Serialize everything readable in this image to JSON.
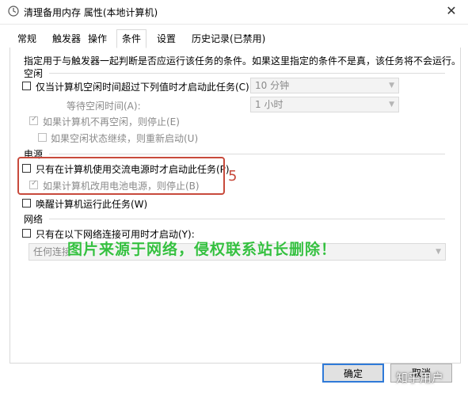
{
  "window": {
    "title": "清理备用内存 属性(本地计算机)",
    "close_label": "✕"
  },
  "tabs": [
    {
      "label": "常规"
    },
    {
      "label": "触发器"
    },
    {
      "label": "操作"
    },
    {
      "label": "条件",
      "active": true
    },
    {
      "label": "设置"
    },
    {
      "label": "历史记录(已禁用)"
    }
  ],
  "conditions": {
    "description": "指定用于与触发器一起判断是否应运行该任务的条件。如果这里指定的条件不是真，该任务将不会运行。",
    "idle": {
      "section_label": "空闲",
      "start_if_idle": {
        "label": "仅当计算机空闲时间超过下列值时才启动此任务(C):",
        "checked": false,
        "dropdown_value": "10 分钟"
      },
      "wait_for_idle": {
        "label": "等待空闲时间(A):",
        "dropdown_value": "1 小时"
      },
      "stop_if_not_idle": {
        "label": "如果计算机不再空闲，则停止(E)",
        "checked": true
      },
      "restart_if_idle_resumes": {
        "label": "如果空闲状态继续，则重新启动(U)",
        "checked": false
      }
    },
    "power": {
      "section_label": "电源",
      "start_only_on_ac": {
        "label": "只有在计算机使用交流电源时才启动此任务(P)",
        "checked": false
      },
      "stop_if_on_battery": {
        "label": "如果计算机改用电池电源，则停止(B)",
        "checked": true
      },
      "wake_to_run": {
        "label": "唤醒计算机运行此任务(W)",
        "checked": false
      }
    },
    "network": {
      "section_label": "网络",
      "start_only_if_network": {
        "label": "只有在以下网络连接可用时才启动(Y):",
        "checked": false,
        "dropdown_value": "任何连接"
      }
    }
  },
  "annotation_number": "5",
  "watermark": "图片来源于网络，侵权联系站长删除！",
  "buttons": {
    "ok": "确定",
    "cancel": "取消"
  },
  "corner_watermark": "知乎用户",
  "colors": {
    "accent": "#2f7ad8",
    "annotation": "#c84a3c",
    "watermark": "#35c040"
  }
}
